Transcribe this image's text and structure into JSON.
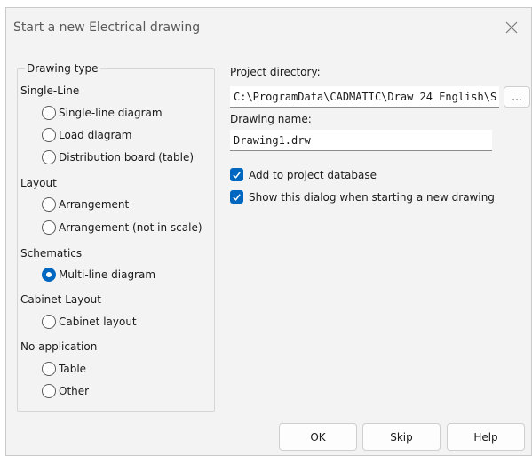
{
  "dialog": {
    "title": "Start a new Electrical drawing",
    "close_icon": "close-icon"
  },
  "drawing_type": {
    "legend": "Drawing type",
    "sections": [
      {
        "label": "Single-Line",
        "options": [
          {
            "label": "Single-line diagram",
            "checked": false
          },
          {
            "label": "Load diagram",
            "checked": false
          },
          {
            "label": "Distribution board (table)",
            "checked": false
          }
        ]
      },
      {
        "label": "Layout",
        "options": [
          {
            "label": "Arrangement",
            "checked": false
          },
          {
            "label": "Arrangement (not in scale)",
            "checked": false
          }
        ]
      },
      {
        "label": "Schematics",
        "options": [
          {
            "label": "Multi-line diagram",
            "checked": true
          }
        ]
      },
      {
        "label": "Cabinet Layout",
        "options": [
          {
            "label": "Cabinet layout",
            "checked": false
          }
        ]
      },
      {
        "label": "No application",
        "options": [
          {
            "label": "Table",
            "checked": false
          },
          {
            "label": "Other",
            "checked": false
          }
        ]
      }
    ]
  },
  "project": {
    "dir_label": "Project directory:",
    "dir_value": "C:\\ProgramData\\CADMATIC\\Draw 24 English\\S",
    "browse_label": "...",
    "name_label": "Drawing name:",
    "name_value": "Drawing1.drw"
  },
  "options": {
    "add_to_db": {
      "label": "Add to project database",
      "checked": true
    },
    "show_dialog": {
      "label": "Show this dialog when starting a new drawing",
      "checked": true
    }
  },
  "buttons": {
    "ok": "OK",
    "skip": "Skip",
    "help": "Help"
  },
  "colors": {
    "accent": "#0067c0",
    "dialog_bg": "#f3f3f3"
  }
}
